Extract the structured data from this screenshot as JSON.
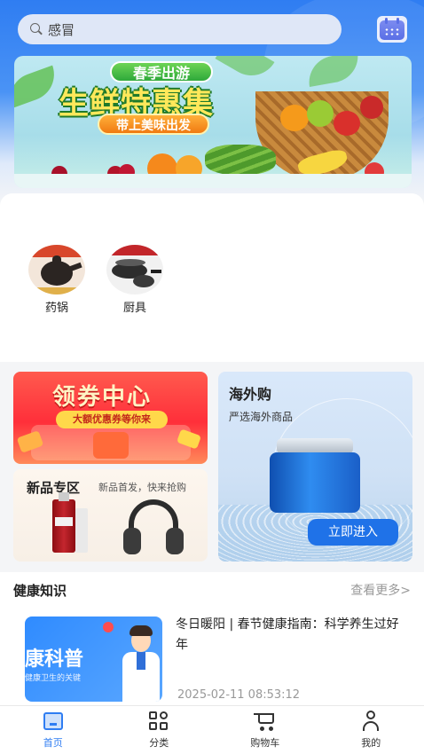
{
  "search": {
    "placeholder": "感冒"
  },
  "banner": {
    "tag": "春季出游",
    "title": "生鲜特惠集",
    "subtitle": "带上美味出发"
  },
  "categories": [
    {
      "label": "药锅"
    },
    {
      "label": "厨具"
    }
  ],
  "promos": {
    "coupon": {
      "title": "领券中心",
      "subtitle": "大额优惠券等你来"
    },
    "new_zone": {
      "title": "新品专区",
      "subtitle": "新品首发，快来抢购"
    },
    "overseas": {
      "title": "海外购",
      "subtitle": "严选海外商品",
      "button": "立即进入"
    }
  },
  "health": {
    "title": "健康知识",
    "more": "查看更多>",
    "article": {
      "image_title": "康科普",
      "image_subtitle": "健康卫生的关键",
      "title": "冬日暖阳 | 春节健康指南：科学养生过好年",
      "time": "2025-02-11 08:53:12"
    }
  },
  "tabs": [
    {
      "label": "首页",
      "icon": "home-icon",
      "active": true
    },
    {
      "label": "分类",
      "icon": "grid-icon",
      "active": false
    },
    {
      "label": "购物车",
      "icon": "cart-icon",
      "active": false
    },
    {
      "label": "我的",
      "icon": "user-icon",
      "active": false
    }
  ],
  "colors": {
    "accent": "#2f7df2",
    "coupon": "#ff2f3a",
    "button": "#1f72e8"
  }
}
